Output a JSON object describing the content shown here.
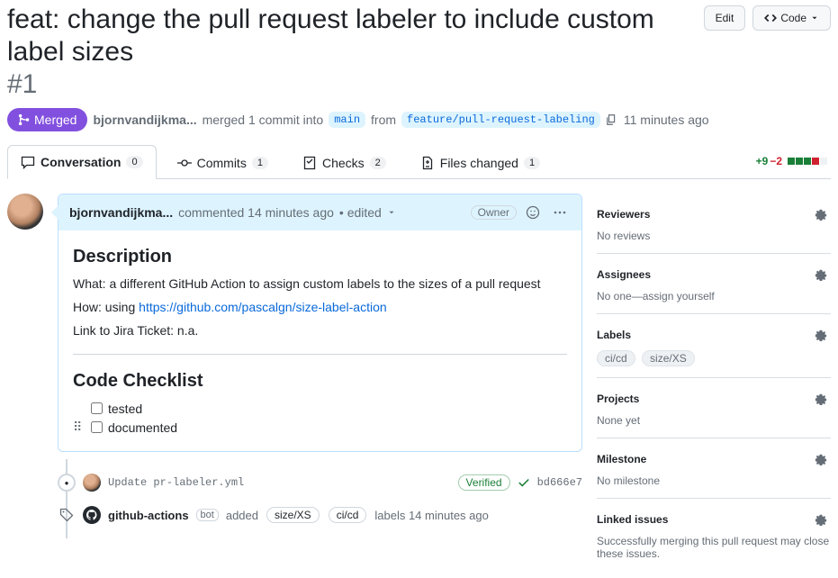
{
  "header": {
    "title": "feat: change the pull request labeler to include custom label sizes",
    "number": "#1",
    "edit_label": "Edit",
    "code_label": "Code"
  },
  "meta": {
    "state": "Merged",
    "author": "bjornvandijkma...",
    "merged_text": "merged 1 commit into",
    "base_branch": "main",
    "from_text": "from",
    "head_branch": "feature/pull-request-labeling",
    "time_ago": "11 minutes ago"
  },
  "tabs": {
    "conversation": {
      "label": "Conversation",
      "count": "0"
    },
    "commits": {
      "label": "Commits",
      "count": "1"
    },
    "checks": {
      "label": "Checks",
      "count": "2"
    },
    "files": {
      "label": "Files changed",
      "count": "1"
    }
  },
  "diffstat": {
    "add": "+9",
    "del": "−2"
  },
  "comment": {
    "author": "bjornvandijkma...",
    "commented": "commented 14 minutes ago",
    "edited": "• edited",
    "owner_badge": "Owner",
    "h_desc": "Description",
    "p_what": "What: a different GitHub Action to assign custom labels to the sizes of a pull request",
    "p_how_prefix": "How: using ",
    "p_how_link": "https://github.com/pascalgn/size-label-action",
    "p_jira": "Link to Jira Ticket: n.a.",
    "h_checklist": "Code Checklist",
    "check1": "tested",
    "check2": "documented"
  },
  "commit_event": {
    "message": "Update pr-labeler.yml",
    "verified": "Verified",
    "sha": "bd666e7"
  },
  "label_event": {
    "actor": "github-actions",
    "bot": "bot",
    "added_text": "added",
    "label1": "size/XS",
    "label2": "ci/cd",
    "suffix": "labels 14 minutes ago"
  },
  "sidebar": {
    "reviewers": {
      "title": "Reviewers",
      "body": "No reviews"
    },
    "assignees": {
      "title": "Assignees",
      "body_prefix": "No one—",
      "body_link": "assign yourself"
    },
    "labels": {
      "title": "Labels",
      "items": [
        "ci/cd",
        "size/XS"
      ]
    },
    "projects": {
      "title": "Projects",
      "body": "None yet"
    },
    "milestone": {
      "title": "Milestone",
      "body": "No milestone"
    },
    "linked": {
      "title": "Linked issues",
      "body": "Successfully merging this pull request may close these issues."
    }
  }
}
